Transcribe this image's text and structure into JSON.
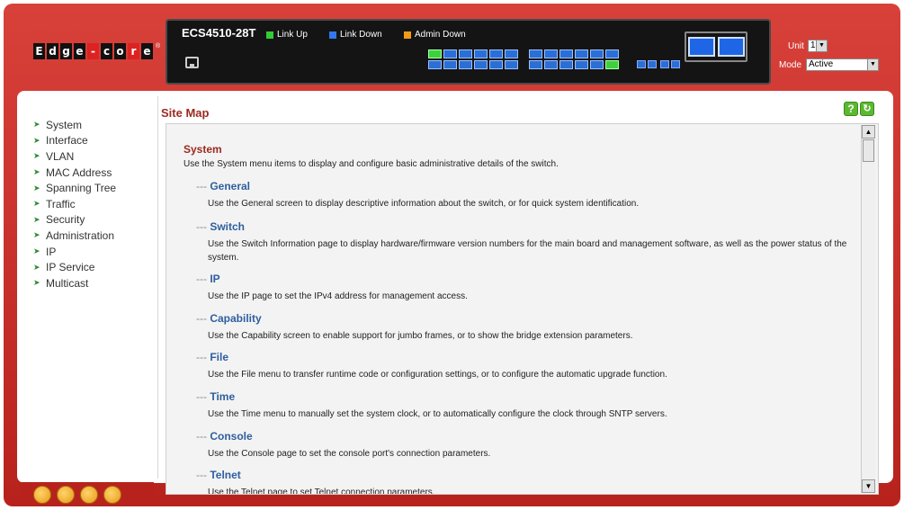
{
  "header": {
    "model": "ECS4510-28T",
    "legend": [
      {
        "label": "Link Up",
        "color": "#33cc33"
      },
      {
        "label": "Link Down",
        "color": "#3377ee"
      },
      {
        "label": "Admin Down",
        "color": "#f09a1a"
      }
    ],
    "unit_label": "Unit",
    "unit_value": "1",
    "mode_label": "Mode",
    "mode_value": "Active"
  },
  "sidebar": {
    "items": [
      {
        "label": "System"
      },
      {
        "label": "Interface"
      },
      {
        "label": "VLAN"
      },
      {
        "label": "MAC Address"
      },
      {
        "label": "Spanning Tree"
      },
      {
        "label": "Traffic"
      },
      {
        "label": "Security"
      },
      {
        "label": "Administration"
      },
      {
        "label": "IP"
      },
      {
        "label": "IP Service"
      },
      {
        "label": "Multicast"
      }
    ]
  },
  "main": {
    "title": "Site Map",
    "section_title": "System",
    "section_desc": "Use the System menu items to display and configure basic administrative details of the switch.",
    "entries": [
      {
        "title": "General",
        "desc": "Use the General screen to display descriptive information about the switch, or for quick system identification."
      },
      {
        "title": "Switch",
        "desc": "Use the Switch Information page to display hardware/firmware version numbers for the main board and management software, as well as the power status of the system."
      },
      {
        "title": "IP",
        "desc": "Use the IP page to set the IPv4 address for management access."
      },
      {
        "title": "Capability",
        "desc": "Use the Capability screen to enable support for jumbo frames, or to show the bridge extension parameters."
      },
      {
        "title": "File",
        "desc": "Use the File menu to transfer runtime code or configuration settings, or to configure the automatic upgrade function."
      },
      {
        "title": "Time",
        "desc": "Use the Time menu to manually set the system clock, or to automatically configure the clock through SNTP servers."
      },
      {
        "title": "Console",
        "desc": "Use the Console page to set the console port's connection parameters."
      },
      {
        "title": "Telnet",
        "desc": "Use the Telnet page to set Telnet connection parameters."
      }
    ]
  }
}
